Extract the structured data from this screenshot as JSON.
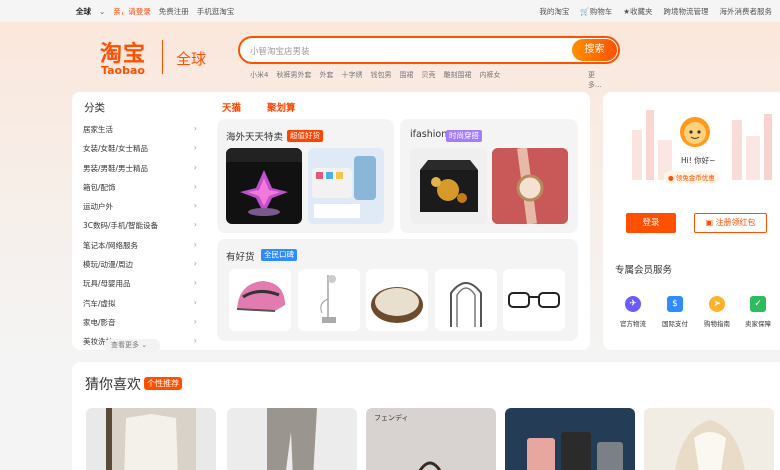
{
  "topbar": {
    "left": [
      "全球",
      "亲，请登录",
      "免费注册",
      "手机逛淘宝"
    ],
    "right": [
      "我的淘宝",
      "购物车",
      "收藏夹",
      "跨境物流管理",
      "海外消费者服务"
    ]
  },
  "logo": {
    "cn": "淘宝",
    "en": "Taobao",
    "region": "全球"
  },
  "search": {
    "placeholder": "小智淘宝店男装",
    "button": "搜索"
  },
  "hot_words": [
    "小米4",
    "秋裤男外套",
    "外套",
    "十字绣",
    "钱包男",
    "围裙",
    "贝壳",
    "雕刻围裙",
    "内裤女"
  ],
  "hot_more": "更多...",
  "categories": {
    "title": "分类",
    "items": [
      "居家生活",
      "女装/女鞋/女士精品",
      "男装/男鞋/男士精品",
      "箱包/配饰",
      "运动户外",
      "3C数码/手机/智能设备",
      "笔记本/网络服务",
      "模玩/动漫/周边",
      "玩具/母婴用品",
      "汽车/虚拟",
      "家电/影音",
      "美妆洗护"
    ],
    "view_more": "查看更多"
  },
  "tabs": [
    "天猫",
    "聚划算"
  ],
  "cards": {
    "overseas": {
      "title": "海外天天特卖",
      "badge": "超值好货"
    },
    "fashion": {
      "title": "ifashion",
      "badge": "时尚穿搭"
    },
    "good": {
      "title": "有好货",
      "badge": "全民口碑"
    }
  },
  "member": {
    "greeting": "Hi! 你好~",
    "coupon": "领免金币优惠",
    "login": "登录",
    "register": "注册领红包",
    "services_title": "专属会员服务",
    "services": [
      "官方物流",
      "国际支付",
      "购物指南",
      "卖家保障"
    ]
  },
  "guess": {
    "title": "猜你喜欢",
    "badge": "个性推荐",
    "card_text": "フェンディ"
  },
  "colors": {
    "brand": "#ff5000",
    "accent": "#ff4400",
    "purple": "#a57cff",
    "blue": "#2f8bff"
  }
}
